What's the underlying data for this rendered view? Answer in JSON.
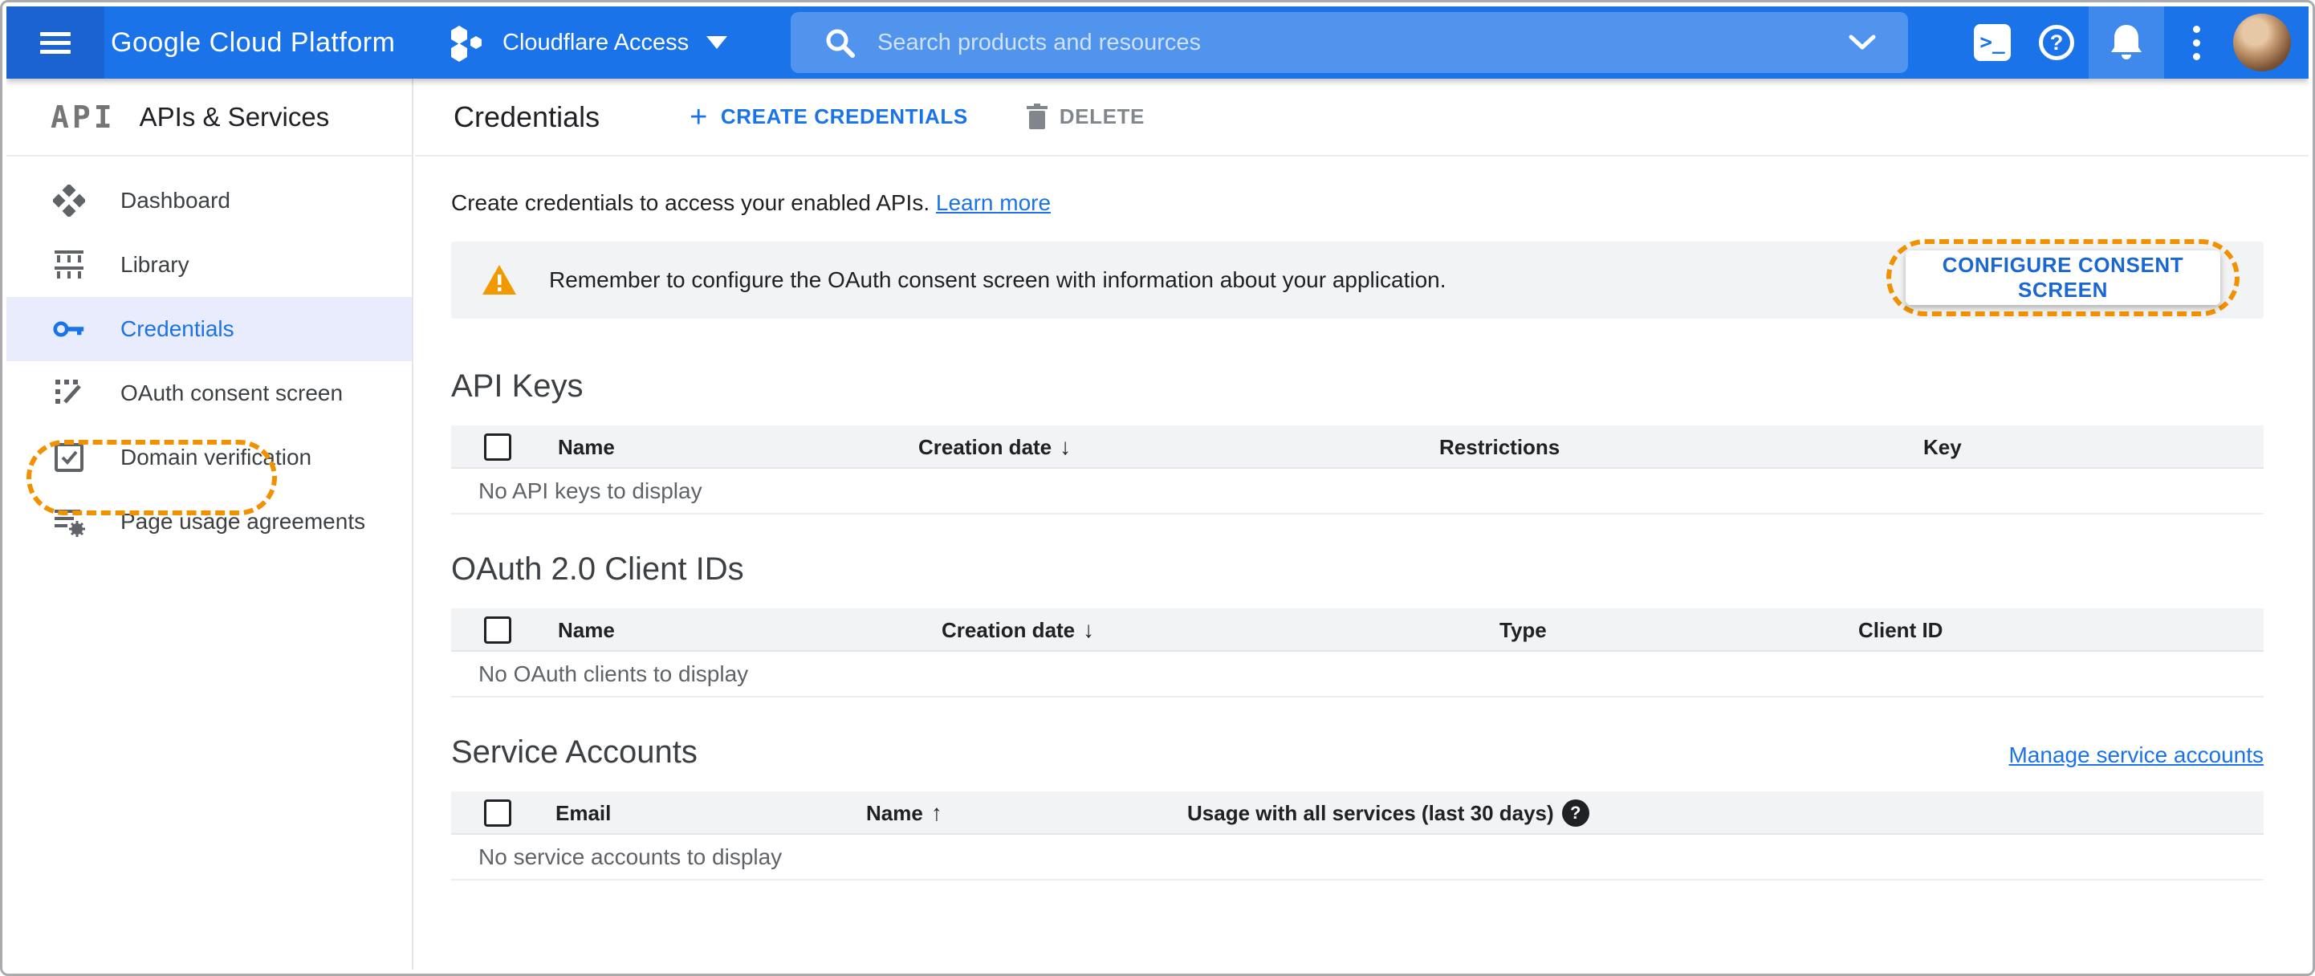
{
  "header": {
    "product": "Google Cloud Platform",
    "project": "Cloudflare Access",
    "search_placeholder": "Search products and resources"
  },
  "sidebar": {
    "logo": "API",
    "title": "APIs & Services",
    "items": [
      {
        "label": "Dashboard"
      },
      {
        "label": "Library"
      },
      {
        "label": "Credentials"
      },
      {
        "label": "OAuth consent screen"
      },
      {
        "label": "Domain verification"
      },
      {
        "label": "Page usage agreements"
      }
    ]
  },
  "toolbar": {
    "title": "Credentials",
    "create": "CREATE CREDENTIALS",
    "delete": "DELETE"
  },
  "content": {
    "intro": "Create credentials to access your enabled APIs.",
    "learn_more": "Learn more",
    "banner": {
      "message": "Remember to configure the OAuth consent screen with information about your application.",
      "action": "CONFIGURE CONSENT SCREEN"
    },
    "api_keys": {
      "title": "API Keys",
      "columns": [
        "Name",
        "Creation date",
        "Restrictions",
        "Key"
      ],
      "sort_column": "Creation date",
      "sort_direction": "desc",
      "empty": "No API keys to display"
    },
    "oauth_clients": {
      "title": "OAuth 2.0 Client IDs",
      "columns": [
        "Name",
        "Creation date",
        "Type",
        "Client ID"
      ],
      "sort_column": "Creation date",
      "sort_direction": "desc",
      "empty": "No OAuth clients to display"
    },
    "service_accounts": {
      "title": "Service Accounts",
      "manage_link": "Manage service accounts",
      "columns": [
        "Email",
        "Name",
        "Usage with all services (last 30 days)"
      ],
      "sort_column": "Name",
      "sort_direction": "asc",
      "empty": "No service accounts to display"
    }
  },
  "icons": {
    "sort_down": "↓",
    "sort_up": "↑",
    "plus": "+",
    "terminal_glyph": ">_",
    "help_glyph": "?"
  },
  "colors": {
    "header_blue": "#1a73e8",
    "header_menu_blue": "#1b63d0",
    "accent_blue": "#1a73e8",
    "active_item_bg": "#e8ecfd",
    "annotation_orange": "#f29100",
    "banner_gray": "#f1f3f4",
    "link_blue": "#1a73e8"
  }
}
